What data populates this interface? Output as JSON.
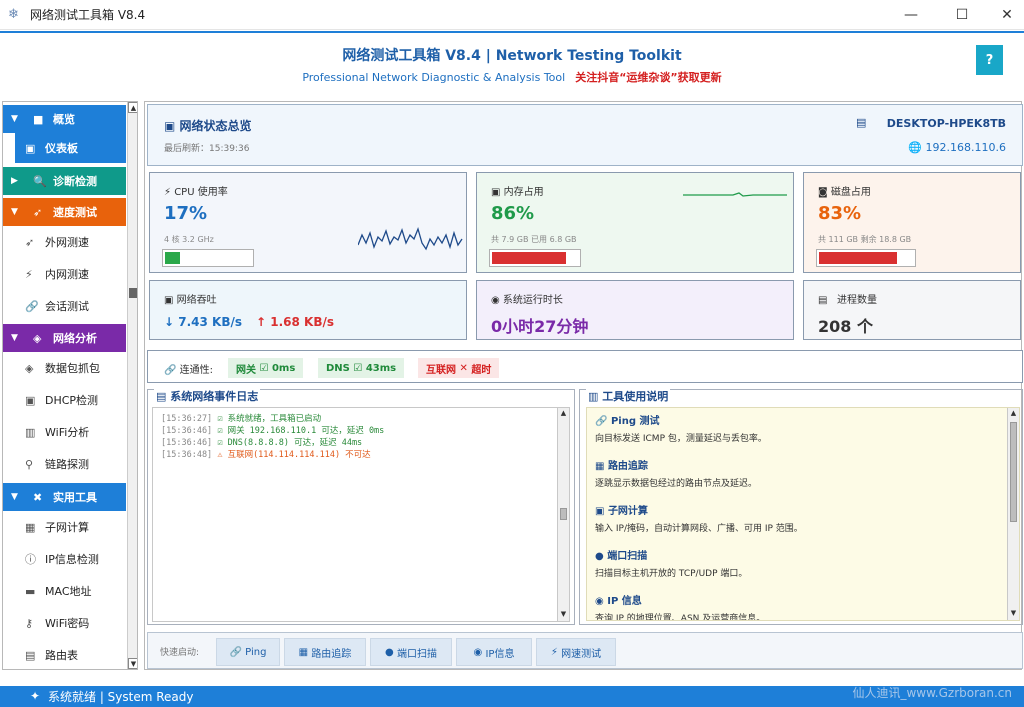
{
  "window": {
    "title": "网络测试工具箱 V8.4",
    "minimize": "—",
    "maximize": "☐",
    "close": "✕"
  },
  "header": {
    "title": "网络测试工具箱 V8.4 | Network Testing Toolkit",
    "subtitle": "Professional Network Diagnostic & Analysis Tool",
    "promo": "关注抖音“运维杂谈”获取更新",
    "help": "?"
  },
  "sidebar": {
    "categories": [
      {
        "label": "概览",
        "color": "#1e7fd8",
        "items": [
          {
            "label": "仪表板",
            "active": true
          }
        ]
      },
      {
        "label": "诊断检测",
        "color": "#0f9a8a",
        "items": []
      },
      {
        "label": "速度测试",
        "color": "#e8620c",
        "items": [
          {
            "label": "外网测速"
          },
          {
            "label": "内网测速"
          },
          {
            "label": "会话测试"
          }
        ]
      },
      {
        "label": "网络分析",
        "color": "#7a2aa8",
        "items": [
          {
            "label": "数据包抓包"
          },
          {
            "label": "DHCP检测"
          },
          {
            "label": "WiFi分析"
          },
          {
            "label": "链路探测"
          }
        ]
      },
      {
        "label": "实用工具",
        "color": "#1e7fd8",
        "items": [
          {
            "label": "子网计算"
          },
          {
            "label": "IP信息检测"
          },
          {
            "label": "MAC地址"
          },
          {
            "label": "WiFi密码"
          },
          {
            "label": "路由表"
          }
        ]
      }
    ]
  },
  "overview": {
    "title": "网络状态总览",
    "refresh": "最后刷新：15:39:36",
    "hostname": "DESKTOP-HPEK8TB",
    "ip": "192.168.110.6"
  },
  "cards": {
    "cpu": {
      "title": "CPU 使用率",
      "value": "17%",
      "sub": "4 核  3.2 GHz",
      "percent": 0.17,
      "color": "#1e6fc0",
      "bar": "#2aa84a"
    },
    "mem": {
      "title": "内存占用",
      "value": "86%",
      "sub": "共 7.9 GB  已用 6.8 GB",
      "percent": 0.86,
      "color": "#1f9a4a",
      "bar": "#d93030"
    },
    "disk": {
      "title": "磁盘占用",
      "value": "83%",
      "sub": "共 111 GB  剩余 18.8 GB",
      "percent": 0.83,
      "color": "#e8620c",
      "bar": "#d93030"
    },
    "net": {
      "title": "网络吞吐",
      "down": "↓ 7.43 KB/s",
      "up": "↑ 1.68 KB/s"
    },
    "uptime": {
      "title": "系统运行时长",
      "value": "0小时27分钟"
    },
    "proc": {
      "title": "进程数量",
      "value": "208 个"
    }
  },
  "connectivity": {
    "label": "连通性:",
    "gateway": {
      "name": "网关",
      "value": "0ms"
    },
    "dns": {
      "name": "DNS",
      "value": "43ms"
    },
    "internet": {
      "name": "互联网",
      "value": "超时"
    }
  },
  "log": {
    "title": "系统网络事件日志",
    "lines": [
      {
        "time": "[15:36:27]",
        "icon": "☑",
        "text": "系统就绪，工具箱已启动",
        "color": "#2a8a3a"
      },
      {
        "time": "[15:36:46]",
        "icon": "☑",
        "text": "网关 192.168.110.1 可达，延迟 0ms",
        "color": "#2a8a3a"
      },
      {
        "time": "[15:36:46]",
        "icon": "☑",
        "text": "DNS(8.8.8.8) 可达，延迟 44ms",
        "color": "#2a8a3a"
      },
      {
        "time": "[15:36:48]",
        "icon": "⚠",
        "text": "互联网(114.114.114.114) 不可达",
        "color": "#e05a1a"
      }
    ]
  },
  "guide": {
    "title": "工具使用说明",
    "items": [
      {
        "icon": "🔗",
        "title": "Ping 测试",
        "desc": "向目标发送 ICMP 包，测量延迟与丢包率。"
      },
      {
        "icon": "▦",
        "title": "路由追踪",
        "desc": "逐跳显示数据包经过的路由节点及延迟。"
      },
      {
        "icon": "▣",
        "title": "子网计算",
        "desc": "输入 IP/掩码，自动计算网段、广播、可用 IP 范围。"
      },
      {
        "icon": "●",
        "title": "端口扫描",
        "desc": "扫描目标主机开放的 TCP/UDP 端口。"
      },
      {
        "icon": "◉",
        "title": "IP 信息",
        "desc": "查询 IP 的地理位置、ASN 及运营商信息。"
      }
    ]
  },
  "quick": {
    "label": "快速启动:",
    "buttons": [
      {
        "icon": "🔗",
        "label": "Ping"
      },
      {
        "icon": "▦",
        "label": "路由追踪"
      },
      {
        "icon": "●",
        "label": "端口扫描"
      },
      {
        "icon": "◉",
        "label": "IP信息"
      },
      {
        "icon": "⚡",
        "label": "网速测试"
      }
    ]
  },
  "status": {
    "text": "系统就绪 | System Ready"
  },
  "watermark": "仙人迪讯_www.Gzrboran.cn"
}
